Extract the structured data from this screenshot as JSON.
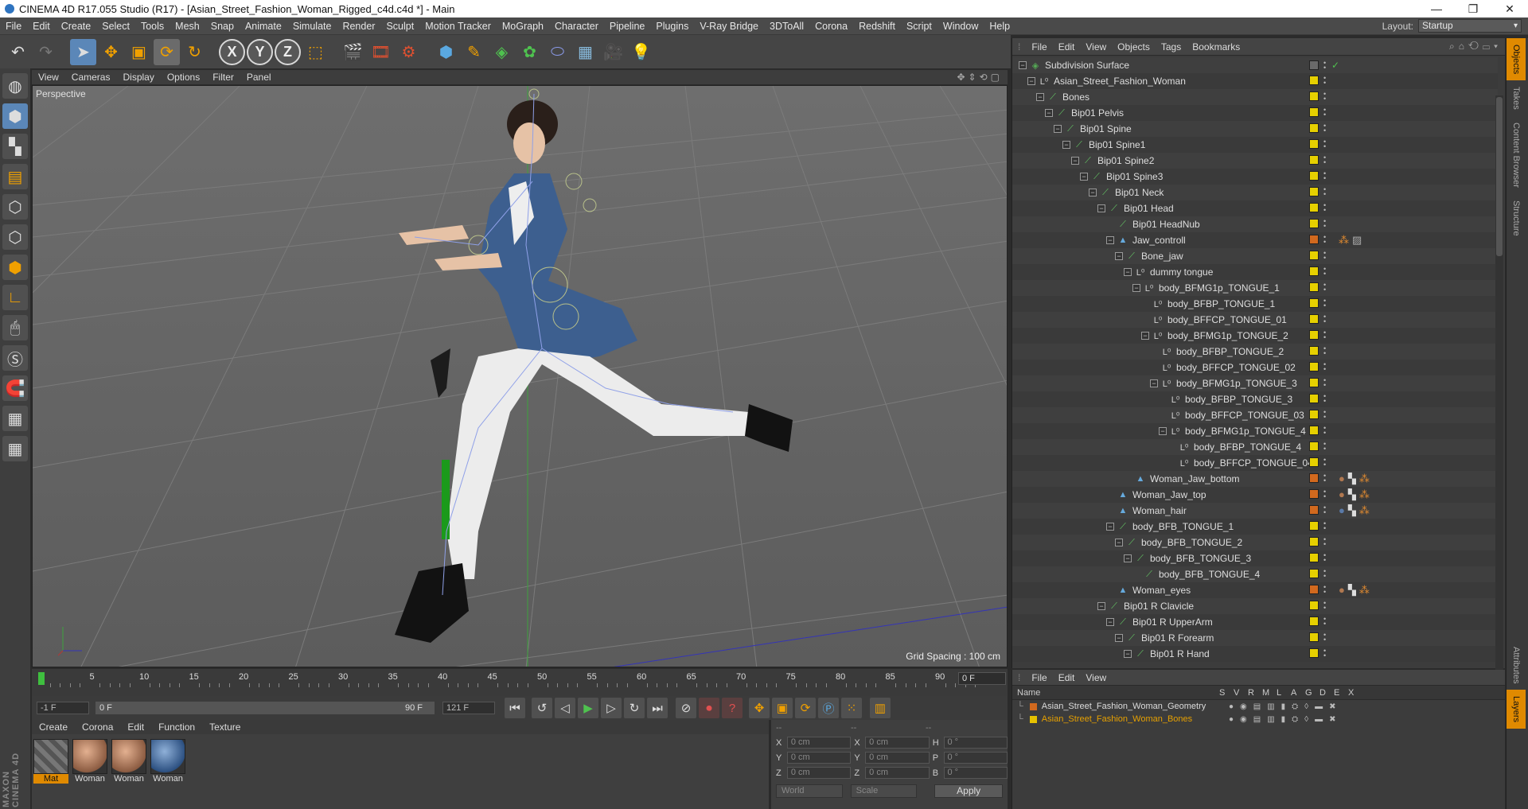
{
  "window": {
    "title": "CINEMA 4D R17.055 Studio (R17) - [Asian_Street_Fashion_Woman_Rigged_c4d.c4d *] - Main"
  },
  "menubar": {
    "items": [
      "File",
      "Edit",
      "Create",
      "Select",
      "Tools",
      "Mesh",
      "Snap",
      "Animate",
      "Simulate",
      "Render",
      "Sculpt",
      "Motion Tracker",
      "MoGraph",
      "Character",
      "Pipeline",
      "Plugins",
      "V-Ray Bridge",
      "3DToAll",
      "Corona",
      "Redshift",
      "Script",
      "Window",
      "Help"
    ],
    "layout_label": "Layout:",
    "layout_value": "Startup"
  },
  "toolbar": {
    "axis_x": "X",
    "axis_y": "Y",
    "axis_z": "Z"
  },
  "viewport": {
    "menu": [
      "View",
      "Cameras",
      "Display",
      "Options",
      "Filter",
      "Panel"
    ],
    "camera_label": "Perspective",
    "grid_spacing": "Grid Spacing : 100 cm"
  },
  "timeline": {
    "ticks": [
      "0",
      "5",
      "10",
      "15",
      "20",
      "25",
      "30",
      "35",
      "40",
      "45",
      "50",
      "55",
      "60",
      "65",
      "70",
      "75",
      "80",
      "85",
      "90"
    ],
    "current_frame": "0 F",
    "start_field": "-1 F",
    "range_start": "0 F",
    "range_end": "90 F",
    "end_field": "121 F"
  },
  "materials": {
    "menu": [
      "Create",
      "Corona",
      "Edit",
      "Function",
      "Texture"
    ],
    "items": [
      {
        "label": "Mat"
      },
      {
        "label": "Woman"
      },
      {
        "label": "Woman"
      },
      {
        "label": "Woman"
      }
    ]
  },
  "coords": {
    "header": [
      "--",
      "--",
      "--"
    ],
    "rows": [
      {
        "a": "X",
        "av": "0 cm",
        "b": "X",
        "bv": "0 cm",
        "c": "H",
        "cv": "0 °"
      },
      {
        "a": "Y",
        "av": "0 cm",
        "b": "Y",
        "bv": "0 cm",
        "c": "P",
        "cv": "0 °"
      },
      {
        "a": "Z",
        "av": "0 cm",
        "b": "Z",
        "bv": "0 cm",
        "c": "B",
        "cv": "0 °"
      }
    ],
    "world": "World",
    "scale": "Scale",
    "apply": "Apply"
  },
  "objects": {
    "menu": [
      "File",
      "Edit",
      "View",
      "Objects",
      "Tags",
      "Bookmarks"
    ],
    "rows": [
      {
        "name": "Subdivision Surface",
        "depth": 0,
        "exp": "-",
        "icon": "subdivision-icon",
        "color": "#55aa55"
      },
      {
        "name": "Asian_Street_Fashion_Woman",
        "depth": 1,
        "exp": "-",
        "icon": "null-icon",
        "color": "#cfcfcf"
      },
      {
        "name": "Bones",
        "depth": 2,
        "exp": "-",
        "icon": "bone-icon",
        "color": "#66cc66"
      },
      {
        "name": "Bip01 Pelvis",
        "depth": 3,
        "exp": "-",
        "icon": "bone-icon",
        "color": "#66cc66"
      },
      {
        "name": "Bip01 Spine",
        "depth": 4,
        "exp": "-",
        "icon": "bone-icon",
        "color": "#66cc66"
      },
      {
        "name": "Bip01 Spine1",
        "depth": 5,
        "exp": "-",
        "icon": "bone-icon",
        "color": "#66cc66"
      },
      {
        "name": "Bip01 Spine2",
        "depth": 6,
        "exp": "-",
        "icon": "bone-icon",
        "color": "#66cc66"
      },
      {
        "name": "Bip01 Spine3",
        "depth": 7,
        "exp": "-",
        "icon": "bone-icon",
        "color": "#66cc66"
      },
      {
        "name": "Bip01 Neck",
        "depth": 8,
        "exp": "-",
        "icon": "bone-icon",
        "color": "#66cc66"
      },
      {
        "name": "Bip01 Head",
        "depth": 9,
        "exp": "-",
        "icon": "bone-icon",
        "color": "#66cc66"
      },
      {
        "name": "Bip01 HeadNub",
        "depth": 10,
        "exp": "",
        "icon": "bone-icon",
        "color": "#66cc66"
      },
      {
        "name": "Jaw_controll",
        "depth": 10,
        "exp": "-",
        "icon": "polygon-icon",
        "color": "#66aadd"
      },
      {
        "name": "Bone_jaw",
        "depth": 11,
        "exp": "-",
        "icon": "bone-icon",
        "color": "#66cc66"
      },
      {
        "name": "dummy tongue",
        "depth": 12,
        "exp": "-",
        "icon": "null-icon",
        "color": "#cfcfcf"
      },
      {
        "name": "body_BFMG1p_TONGUE_1",
        "depth": 13,
        "exp": "-",
        "icon": "null-icon",
        "color": "#cfcfcf"
      },
      {
        "name": "body_BFBP_TONGUE_1",
        "depth": 14,
        "exp": "",
        "icon": "null-icon",
        "color": "#cfcfcf"
      },
      {
        "name": "body_BFFCP_TONGUE_01",
        "depth": 14,
        "exp": "",
        "icon": "null-icon",
        "color": "#cfcfcf"
      },
      {
        "name": "body_BFMG1p_TONGUE_2",
        "depth": 14,
        "exp": "-",
        "icon": "null-icon",
        "color": "#cfcfcf"
      },
      {
        "name": "body_BFBP_TONGUE_2",
        "depth": 15,
        "exp": "",
        "icon": "null-icon",
        "color": "#cfcfcf"
      },
      {
        "name": "body_BFFCP_TONGUE_02",
        "depth": 15,
        "exp": "",
        "icon": "null-icon",
        "color": "#cfcfcf"
      },
      {
        "name": "body_BFMG1p_TONGUE_3",
        "depth": 15,
        "exp": "-",
        "icon": "null-icon",
        "color": "#cfcfcf"
      },
      {
        "name": "body_BFBP_TONGUE_3",
        "depth": 16,
        "exp": "",
        "icon": "null-icon",
        "color": "#cfcfcf"
      },
      {
        "name": "body_BFFCP_TONGUE_03",
        "depth": 16,
        "exp": "",
        "icon": "null-icon",
        "color": "#cfcfcf"
      },
      {
        "name": "body_BFMG1p_TONGUE_4",
        "depth": 16,
        "exp": "-",
        "icon": "null-icon",
        "color": "#cfcfcf"
      },
      {
        "name": "body_BFBP_TONGUE_4",
        "depth": 17,
        "exp": "",
        "icon": "null-icon",
        "color": "#cfcfcf"
      },
      {
        "name": "body_BFFCP_TONGUE_04",
        "depth": 17,
        "exp": "",
        "icon": "null-icon",
        "color": "#cfcfcf"
      },
      {
        "name": "Woman_Jaw_bottom",
        "depth": 12,
        "exp": "",
        "icon": "polygon-icon",
        "color": "#66aadd"
      },
      {
        "name": "Woman_Jaw_top",
        "depth": 10,
        "exp": "",
        "icon": "polygon-icon",
        "color": "#66aadd"
      },
      {
        "name": "Woman_hair",
        "depth": 10,
        "exp": "",
        "icon": "polygon-icon",
        "color": "#66aadd"
      },
      {
        "name": "body_BFB_TONGUE_1",
        "depth": 10,
        "exp": "-",
        "icon": "bone-icon",
        "color": "#66cc66"
      },
      {
        "name": "body_BFB_TONGUE_2",
        "depth": 11,
        "exp": "-",
        "icon": "bone-icon",
        "color": "#66cc66"
      },
      {
        "name": "body_BFB_TONGUE_3",
        "depth": 12,
        "exp": "-",
        "icon": "bone-icon",
        "color": "#66cc66"
      },
      {
        "name": "body_BFB_TONGUE_4",
        "depth": 13,
        "exp": "",
        "icon": "bone-icon",
        "color": "#66cc66"
      },
      {
        "name": "Woman_eyes",
        "depth": 10,
        "exp": "",
        "icon": "polygon-icon",
        "color": "#66aadd"
      },
      {
        "name": "Bip01 R Clavicle",
        "depth": 9,
        "exp": "-",
        "icon": "bone-icon",
        "color": "#66cc66"
      },
      {
        "name": "Bip01 R UpperArm",
        "depth": 10,
        "exp": "-",
        "icon": "bone-icon",
        "color": "#66cc66"
      },
      {
        "name": "Bip01 R Forearm",
        "depth": 11,
        "exp": "-",
        "icon": "bone-icon",
        "color": "#66cc66"
      },
      {
        "name": "Bip01 R Hand",
        "depth": 12,
        "exp": "-",
        "icon": "bone-icon",
        "color": "#66cc66"
      }
    ]
  },
  "side_tabs": [
    "Objects",
    "Takes",
    "Content Browser",
    "Structure"
  ],
  "side_tabs_lower": [
    "Attributes",
    "Layers"
  ],
  "layers": {
    "menu": [
      "File",
      "Edit",
      "View"
    ],
    "columns": [
      "Name",
      "S",
      "V",
      "R",
      "M",
      "L",
      "A",
      "G",
      "D",
      "E",
      "X"
    ],
    "rows": [
      {
        "name": "Asian_Street_Fashion_Woman_Geometry",
        "color": "#d2691e"
      },
      {
        "name": "Asian_Street_Fashion_Woman_Bones",
        "color": "#e6c200"
      }
    ]
  },
  "brand": "MAXON CINEMA 4D"
}
